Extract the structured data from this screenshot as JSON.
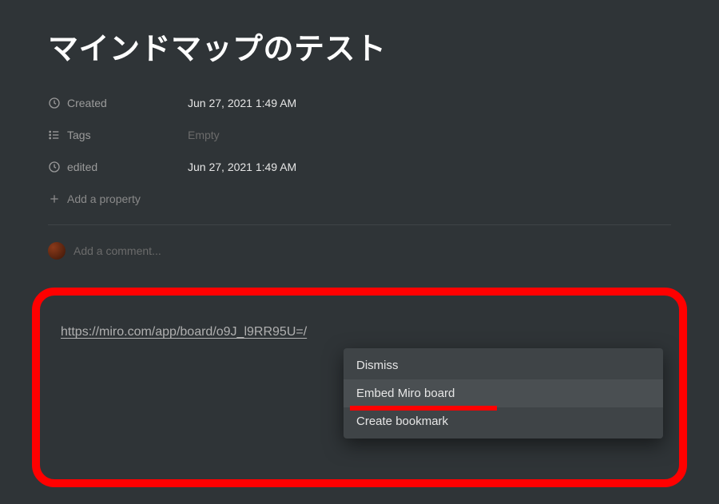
{
  "page": {
    "title": "マインドマップのテスト"
  },
  "properties": {
    "created": {
      "label": "Created",
      "value": "Jun 27, 2021 1:49 AM"
    },
    "tags": {
      "label": "Tags",
      "value": "Empty"
    },
    "edited": {
      "label": "edited",
      "value": "Jun 27, 2021 1:49 AM"
    },
    "add": {
      "label": "Add a property"
    }
  },
  "comment": {
    "placeholder": "Add a comment..."
  },
  "link": {
    "url": "https://miro.com/app/board/o9J_l9RR95U=/"
  },
  "dropdown": {
    "items": [
      "Dismiss",
      "Embed Miro board",
      "Create bookmark"
    ]
  }
}
